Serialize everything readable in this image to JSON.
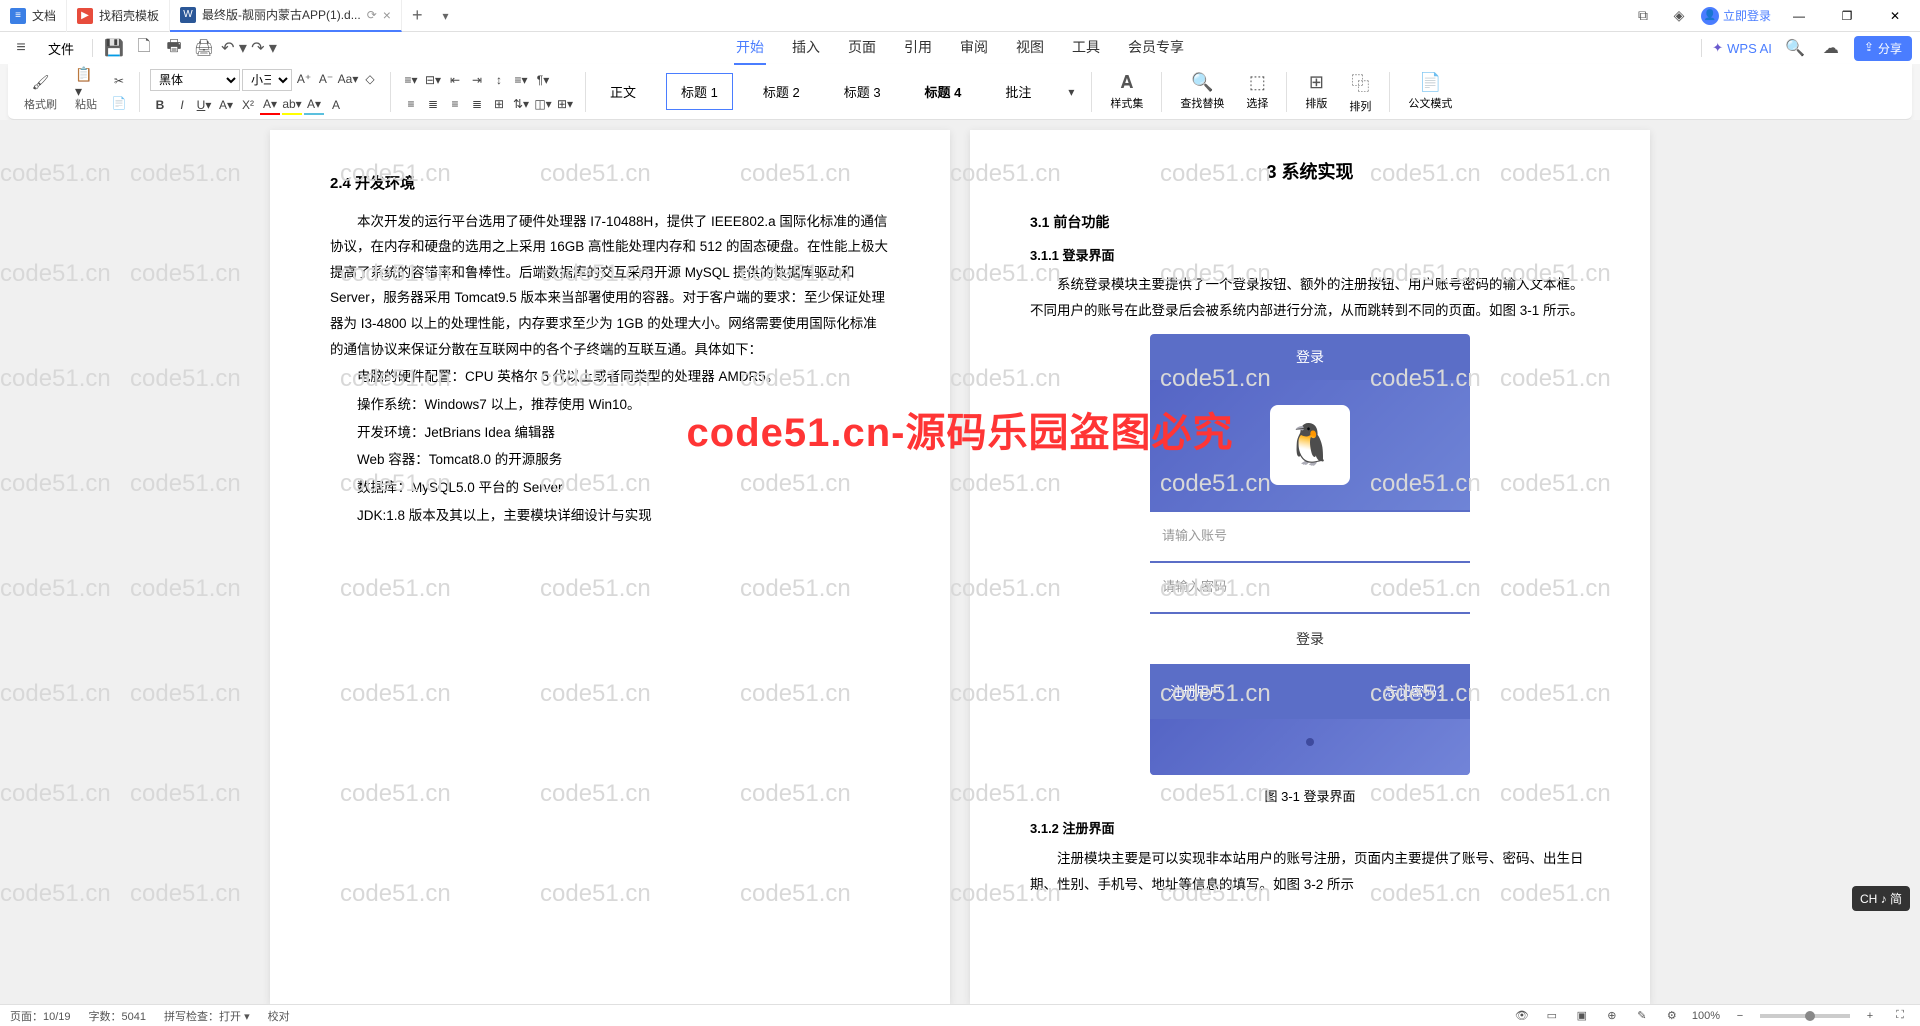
{
  "tabs": [
    {
      "icon": "doc",
      "label": "文档"
    },
    {
      "icon": "tpl",
      "label": "找稻壳模板"
    },
    {
      "icon": "word",
      "label": "最终版-靓丽内蒙古APP(1).d..."
    }
  ],
  "login_text": "立即登录",
  "menu": {
    "file": "文件",
    "tabs": [
      "开始",
      "插入",
      "页面",
      "引用",
      "审阅",
      "视图",
      "工具",
      "会员专享"
    ],
    "wps_ai": "WPS AI",
    "share": "分享"
  },
  "ribbon": {
    "format_brush": "格式刷",
    "paste": "粘贴",
    "font_name": "黑体",
    "font_size": "小三",
    "styles": {
      "normal": "正文",
      "h1": "标题 1",
      "h2": "标题 2",
      "h3": "标题 3",
      "h4": "标题 4",
      "note": "批注"
    },
    "style_set": "样式集",
    "find_replace": "查找替换",
    "select": "选择",
    "sort": "排版",
    "arrange": "排列",
    "doc_mode": "公文模式"
  },
  "doc_left": {
    "h2_4": "2.4 开发环境",
    "p1": "本次开发的运行平台选用了硬件处理器 I7-10488H，提供了 IEEE802.a 国际化标准的通信协议，在内存和硬盘的选用之上采用 16GB 高性能处理内存和 512 的固态硬盘。在性能上极大提高了系统的容错率和鲁棒性。后端数据库的交互采用开源 MySQL 提供的数据库驱动和 Server，服务器采用 Tomcat9.5 版本来当部署使用的容器。对于客户端的要求：至少保证处理器为 I3-4800 以上的处理性能，内存要求至少为 1GB 的处理大小。网络需要使用国际化标准的通信协议来保证分散在互联网中的各个子终端的互联互通。具体如下：",
    "l1": "电脑的硬件配置：CPU 英格尔 5 代以上或者同类型的处理器 AMDR5。",
    "l2": "操作系统：Windows7 以上，推荐使用 Win10。",
    "l3": "开发环境：JetBrians Idea 编辑器",
    "l4": "Web 容器：Tomcat8.0 的开源服务",
    "l5": "数据库：MySQL5.0 平台的 Server",
    "l6": "JDK:1.8 版本及其以上，主要模块详细设计与实现"
  },
  "doc_right": {
    "h1": "3  系统实现",
    "h3_1": "3.1 前台功能",
    "h3_1_1": "3.1.1 登录界面",
    "p1": "系统登录模块主要提供了一个登录按钮、额外的注册按钮、用户账号密码的输入文本框。不同用户的账号在此登录后会被系统内部进行分流，从而跳转到不同的页面。如图 3-1 所示。",
    "login": {
      "title": "登录",
      "ph_user": "请输入账号",
      "ph_pass": "请输入密码",
      "btn": "登录",
      "register": "注册用户",
      "forgot": "忘记密码？"
    },
    "fig3_1": "图 3-1 登录界面",
    "h3_1_2": "3.1.2 注册界面",
    "p2": "注册模块主要是可以实现非本站用户的账号注册，页面内主要提供了账号、密码、出生日期、性别、手机号、地址等信息的填写。如图 3-2 所示"
  },
  "watermark_text": "code51.cn",
  "big_watermark": "code51.cn-源码乐园盗图必究",
  "status": {
    "page": "页面：10/19",
    "words": "字数：5041",
    "spell": "拼写检查：打开",
    "proof": "校对",
    "zoom": "100%"
  },
  "ime": "CH ♪ 简"
}
